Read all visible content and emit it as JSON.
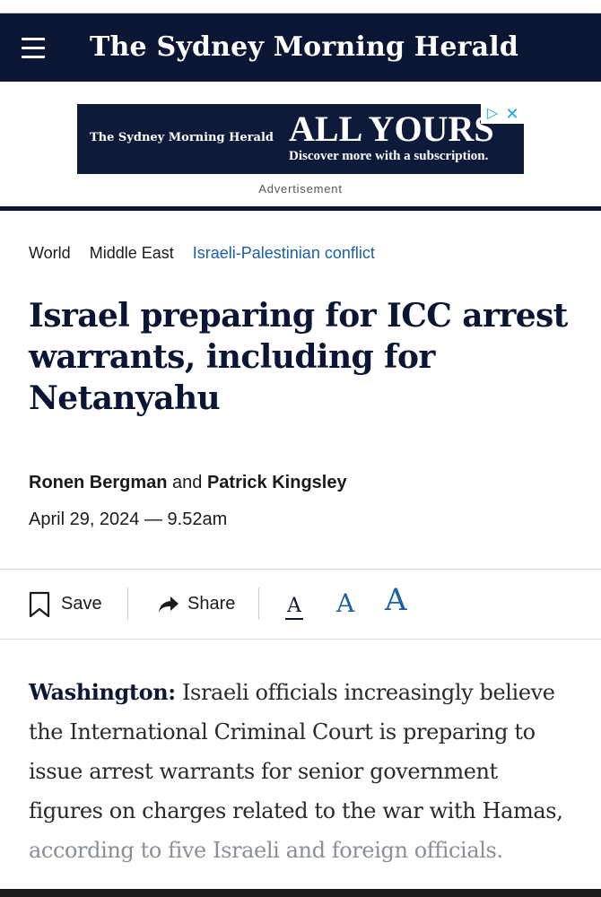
{
  "header": {
    "masthead": "The Sydney Morning Herald",
    "menu_icon": "hamburger-menu-icon",
    "background_color": "#0a1633"
  },
  "ad": {
    "logo_text": "The Sydney Morning Herald",
    "headline": "ALL YOURS",
    "subline": "Discover more with a subscription.",
    "label": "Advertisement",
    "choices_icons": [
      "ad-choices-icon",
      "close-icon"
    ]
  },
  "breadcrumbs": [
    {
      "label": "World"
    },
    {
      "label": "Middle East"
    },
    {
      "label": "Israeli-Palestinian conflict"
    }
  ],
  "article": {
    "headline": "Israel preparing for ICC arrest warrants, including for Netanyahu",
    "authors": [
      "Ronen Bergman",
      "Patrick Kingsley"
    ],
    "author_joiner": "and",
    "date": "April 29, 2024 — 9.52am",
    "dateline": "Washington:",
    "body_text": "Israeli officials increasingly believe the International Criminal Court is preparing to issue arrest warrants for senior government figures on charges related to the war with Hamas,",
    "body_text_faded": "according to five Israeli and foreign officials."
  },
  "toolbar": {
    "save_label": "Save",
    "share_label": "Share",
    "font_small": "A",
    "font_medium": "A",
    "font_large": "A"
  },
  "colors": {
    "navy": "#0a1633",
    "link_blue": "#1b5fa6"
  }
}
